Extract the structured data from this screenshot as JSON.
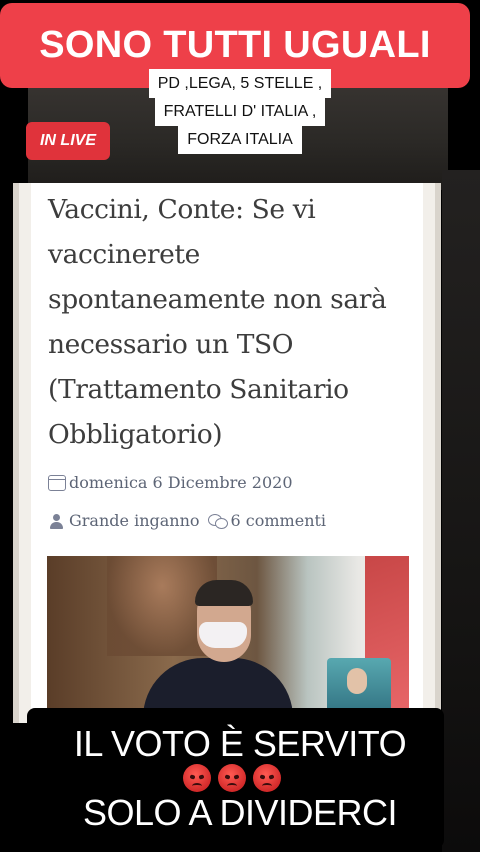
{
  "overlay": {
    "title": "SONO TUTTI UGUALI",
    "parties": [
      "PD ,LEGA, 5 STELLE ,",
      "FRATELLI D' ITALIA ,",
      "FORZA ITALIA"
    ],
    "live_badge": "IN LIVE"
  },
  "article": {
    "headline": "Vaccini, Conte: Se vi vaccinerete spontaneamente non sarà necessario un TSO (Trattamento Sanitario Obbligatorio)",
    "date": "domenica 6 Dicembre 2020",
    "author": "Grande inganno",
    "comments": "6 commenti",
    "date_icon": "calendar-icon",
    "author_icon": "user-icon",
    "comments_icon": "comments-icon"
  },
  "caption": {
    "line1": "IL VOTO È SERVITO",
    "emoji": "angry-face",
    "line2": "SOLO A DIVIDERCI"
  },
  "colors": {
    "banner": "#ee4049",
    "live": "#e0333b",
    "meta_text": "#5d6576"
  }
}
